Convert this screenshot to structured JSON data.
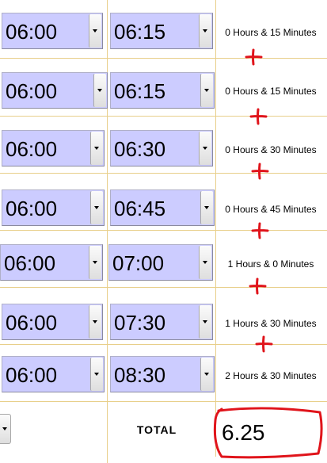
{
  "rows": [
    {
      "start": "06:00",
      "end": "06:15",
      "duration": "0 Hours & 15 Minutes"
    },
    {
      "start": "06:00",
      "end": "06:15",
      "duration": "0 Hours & 15 Minutes"
    },
    {
      "start": "06:00",
      "end": "06:30",
      "duration": "0 Hours & 30 Minutes"
    },
    {
      "start": "06:00",
      "end": "06:45",
      "duration": "0 Hours & 45 Minutes"
    },
    {
      "start": "06:00",
      "end": "07:00",
      "duration": "1 Hours & 0 Minutes"
    },
    {
      "start": "06:00",
      "end": "07:30",
      "duration": "1 Hours & 30 Minutes"
    },
    {
      "start": "06:00",
      "end": "08:30",
      "duration": "2 Hours & 30 Minutes"
    }
  ],
  "total": {
    "label": "TOTAL",
    "value": "6.25"
  },
  "annotation_color": "#e0141b",
  "field_color": "#ccccff",
  "grid_color": "#e8cf8a",
  "icons": {
    "dropdown": "chevron-down-icon",
    "plus": "plus-icon"
  }
}
